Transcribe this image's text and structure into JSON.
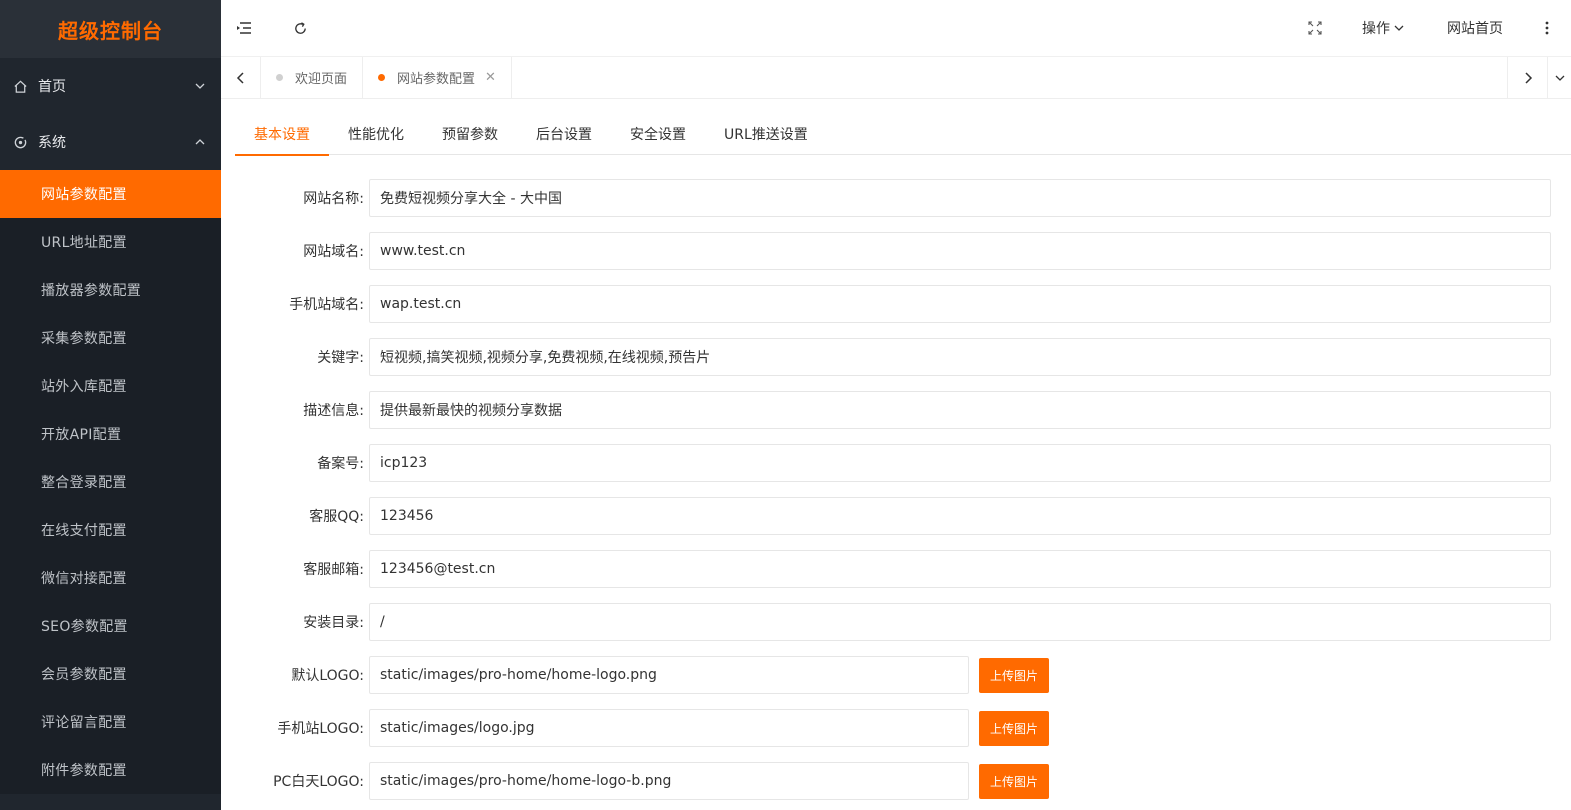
{
  "brand": {
    "title": "超级控制台",
    "accent": "#ff6a00"
  },
  "sidebar": {
    "groups": [
      {
        "label": "首页",
        "icon": "home-icon",
        "expanded": false
      },
      {
        "label": "系统",
        "icon": "system-icon",
        "expanded": true
      }
    ],
    "items": [
      {
        "label": "网站参数配置",
        "active": true
      },
      {
        "label": "URL地址配置"
      },
      {
        "label": "播放器参数配置"
      },
      {
        "label": "采集参数配置"
      },
      {
        "label": "站外入库配置"
      },
      {
        "label": "开放API配置"
      },
      {
        "label": "整合登录配置"
      },
      {
        "label": "在线支付配置"
      },
      {
        "label": "微信对接配置"
      },
      {
        "label": "SEO参数配置"
      },
      {
        "label": "会员参数配置"
      },
      {
        "label": "评论留言配置"
      },
      {
        "label": "附件参数配置"
      }
    ]
  },
  "topbar": {
    "operate_label": "操作",
    "home_label": "网站首页"
  },
  "tabs": [
    {
      "label": "欢迎页面",
      "active": false
    },
    {
      "label": "网站参数配置",
      "active": true
    }
  ],
  "subtabs": [
    "基本设置",
    "性能优化",
    "预留参数",
    "后台设置",
    "安全设置",
    "URL推送设置"
  ],
  "form": {
    "upload_label": "上传图片",
    "fields": [
      {
        "label": "网站名称:",
        "value": "免费短视频分享大全 - 大中国"
      },
      {
        "label": "网站域名:",
        "value": "www.test.cn"
      },
      {
        "label": "手机站域名:",
        "value": "wap.test.cn"
      },
      {
        "label": "关键字:",
        "value": "短视频,搞笑视频,视频分享,免费视频,在线视频,预告片"
      },
      {
        "label": "描述信息:",
        "value": "提供最新最快的视频分享数据"
      },
      {
        "label": "备案号:",
        "value": "icp123"
      },
      {
        "label": "客服QQ:",
        "value": "123456"
      },
      {
        "label": "客服邮箱:",
        "value": "123456@test.cn"
      },
      {
        "label": "安装目录:",
        "value": "/"
      },
      {
        "label": "默认LOGO:",
        "value": "static/images/pro-home/home-logo.png"
      },
      {
        "label": "手机站LOGO:",
        "value": "static/images/logo.jpg"
      },
      {
        "label": "PC白天LOGO:",
        "value": "static/images/pro-home/home-logo-b.png"
      }
    ]
  }
}
